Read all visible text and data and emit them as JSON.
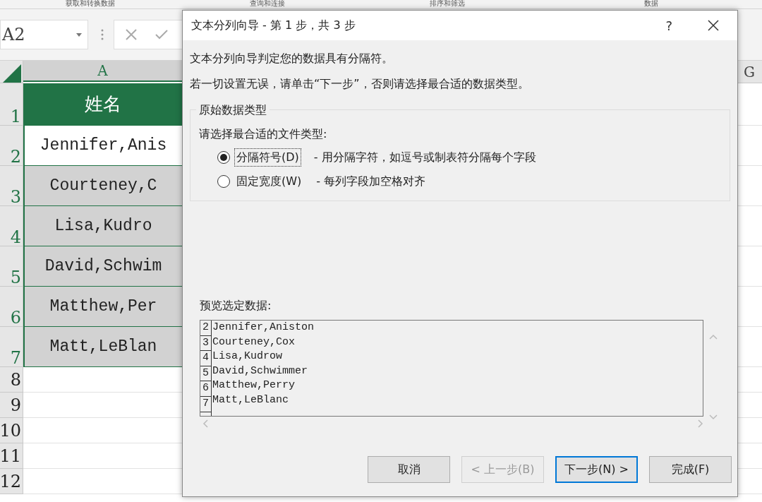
{
  "ribbon_groups": [
    "获取和转换数据",
    "查询和连接",
    "排序和筛选",
    "数据"
  ],
  "name_box": {
    "value": "A2"
  },
  "columns": [
    "A",
    "G"
  ],
  "rows": [
    {
      "number": "1",
      "value": "姓名",
      "kind": "header"
    },
    {
      "number": "2",
      "value": "Jennifer,Anis",
      "kind": "active"
    },
    {
      "number": "3",
      "value": "Courteney,C",
      "kind": "selected"
    },
    {
      "number": "4",
      "value": "Lisa,Kudro",
      "kind": "selected"
    },
    {
      "number": "5",
      "value": "David,Schwim",
      "kind": "selected"
    },
    {
      "number": "6",
      "value": "Matthew,Per",
      "kind": "selected"
    },
    {
      "number": "7",
      "value": "Matt,LeBlan",
      "kind": "selected"
    },
    {
      "number": "8",
      "kind": "empty"
    },
    {
      "number": "9",
      "kind": "empty"
    },
    {
      "number": "10",
      "kind": "empty"
    },
    {
      "number": "11",
      "kind": "empty"
    },
    {
      "number": "12",
      "kind": "empty"
    }
  ],
  "dialog": {
    "title": "文本分列向导 - 第 1 步，共 3 步",
    "help": "?",
    "messages": [
      "文本分列向导判定您的数据具有分隔符。",
      "若一切设置无误，请单击“下一步”，否则请选择最合适的数据类型。"
    ],
    "group_title": "原始数据类型",
    "prompt": "请选择最合适的文件类型:",
    "options": [
      {
        "label": "分隔符号(D)",
        "description": "- 用分隔字符，如逗号或制表符分隔每个字段",
        "selected": true
      },
      {
        "label": "固定宽度(W)",
        "description": "- 每列字段加空格对齐",
        "selected": false
      }
    ],
    "preview_label": "预览选定数据:",
    "preview_rows": [
      {
        "number": "2",
        "text": "Jennifer,Aniston"
      },
      {
        "number": "3",
        "text": "Courteney,Cox"
      },
      {
        "number": "4",
        "text": "Lisa,Kudrow"
      },
      {
        "number": "5",
        "text": "David,Schwimmer"
      },
      {
        "number": "6",
        "text": "Matthew,Perry"
      },
      {
        "number": "7",
        "text": "Matt,LeBlanc"
      }
    ],
    "buttons": [
      {
        "label": "取消",
        "disabled": false,
        "default": false
      },
      {
        "label": "< 上一步(B)",
        "disabled": true,
        "default": false
      },
      {
        "label": "下一步(N) >",
        "disabled": false,
        "default": true
      },
      {
        "label": "完成(F)",
        "disabled": false,
        "default": false
      }
    ]
  }
}
